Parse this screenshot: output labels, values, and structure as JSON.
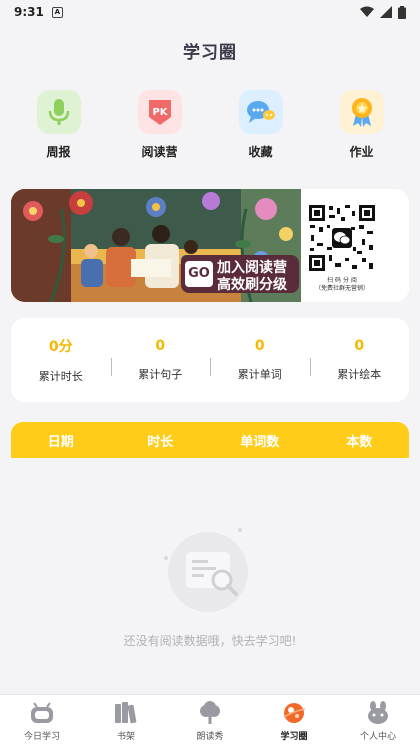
{
  "status": {
    "time": "9:31",
    "notif_letter": "A"
  },
  "header": {
    "title": "学习圈"
  },
  "quick_actions": [
    {
      "label": "周报",
      "icon": "microphone-icon"
    },
    {
      "label": "阅读营",
      "icon": "pk-shield-icon"
    },
    {
      "label": "收藏",
      "icon": "chat-bubbles-icon"
    },
    {
      "label": "作业",
      "icon": "medal-icon"
    }
  ],
  "banner": {
    "go_badge": "GO",
    "line1": "加入阅读营",
    "line2": "高效刷分级",
    "qr_caption_1": "扫 码 分 阅",
    "qr_caption_2": "（免费社群无营销）"
  },
  "stats": [
    {
      "value": "0分",
      "label": "累计时长"
    },
    {
      "value": "0",
      "label": "累计句子"
    },
    {
      "value": "0",
      "label": "累计单词"
    },
    {
      "value": "0",
      "label": "累计绘本"
    }
  ],
  "table": {
    "columns": [
      "日期",
      "时长",
      "单词数",
      "本数"
    ]
  },
  "empty": {
    "message": "还没有阅读数据哦，快去学习吧!"
  },
  "tabs": [
    {
      "label": "今日学习",
      "icon": "robot-tv-icon",
      "active": false
    },
    {
      "label": "书架",
      "icon": "books-icon",
      "active": false
    },
    {
      "label": "朗读秀",
      "icon": "tree-icon",
      "active": false
    },
    {
      "label": "学习圈",
      "icon": "planet-icon",
      "active": true
    },
    {
      "label": "个人中心",
      "icon": "bunny-icon",
      "active": false
    }
  ],
  "colors": {
    "accent": "#ffcc1a",
    "stat_value": "#f5b800",
    "mic_bg": "#dff2d3",
    "pk_bg": "#fde3e3",
    "chat_bg": "#dcefff",
    "medal_bg": "#fff1d4"
  }
}
